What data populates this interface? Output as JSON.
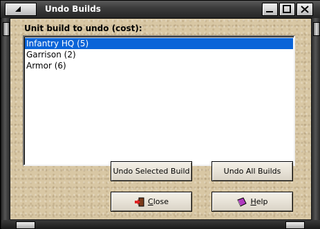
{
  "window": {
    "title": "Undo Builds"
  },
  "list": {
    "label": "Unit build to undo (cost):",
    "items": [
      {
        "text": "Infantry HQ (5)",
        "selected": true
      },
      {
        "text": "Garrison (2)",
        "selected": false
      },
      {
        "text": "Armor (6)",
        "selected": false
      }
    ]
  },
  "buttons": {
    "undo_selected": "Undo Selected Build",
    "undo_all": "Undo All Builds",
    "close_first": "C",
    "close_rest": "lose",
    "help_first": "H",
    "help_rest": "elp"
  },
  "icons": {
    "close": "exit-door-icon",
    "help": "help-book-icon"
  },
  "colors": {
    "selection": "#0a64d8",
    "background": "#d8c7a4"
  }
}
